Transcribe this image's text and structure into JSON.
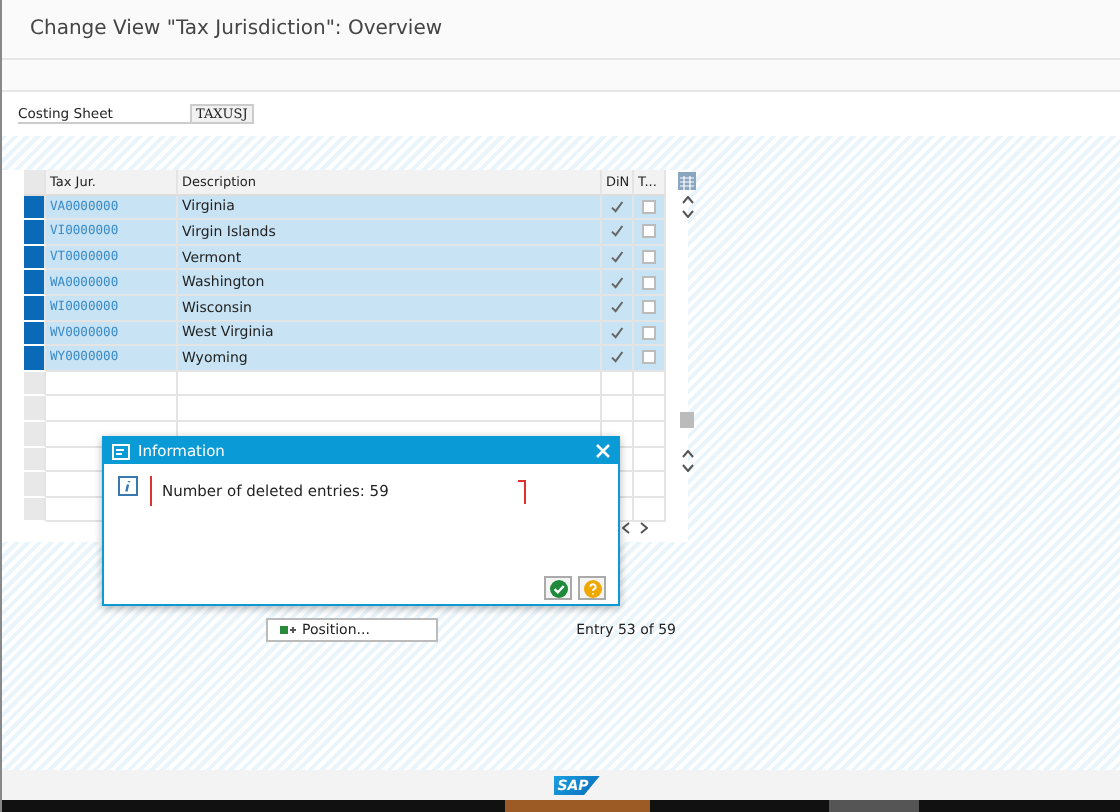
{
  "window": {
    "title": "Change View \"Tax Jurisdiction\": Overview"
  },
  "header_field": {
    "label": "Costing Sheet",
    "value": "TAXUSJ"
  },
  "table": {
    "columns": [
      "Tax Jur.",
      "Description",
      "DiN",
      "T..."
    ],
    "rows": [
      {
        "tax_jur": "VA0000000",
        "description": "Virginia",
        "din": true,
        "t": false,
        "selected": true
      },
      {
        "tax_jur": "VI0000000",
        "description": "Virgin Islands",
        "din": true,
        "t": false,
        "selected": true
      },
      {
        "tax_jur": "VT0000000",
        "description": "Vermont",
        "din": true,
        "t": false,
        "selected": true
      },
      {
        "tax_jur": "WA0000000",
        "description": "Washington",
        "din": true,
        "t": false,
        "selected": true
      },
      {
        "tax_jur": "WI0000000",
        "description": "Wisconsin",
        "din": true,
        "t": false,
        "selected": true
      },
      {
        "tax_jur": "WV0000000",
        "description": "West Virginia",
        "din": true,
        "t": false,
        "selected": true
      },
      {
        "tax_jur": "WY0000000",
        "description": "Wyoming",
        "din": true,
        "t": false,
        "selected": true
      }
    ]
  },
  "position_button": "Position...",
  "entry_info": "Entry 53 of 59",
  "dialog": {
    "title": "Information",
    "message": "Number of deleted entries: 59"
  },
  "logo": "SAP"
}
